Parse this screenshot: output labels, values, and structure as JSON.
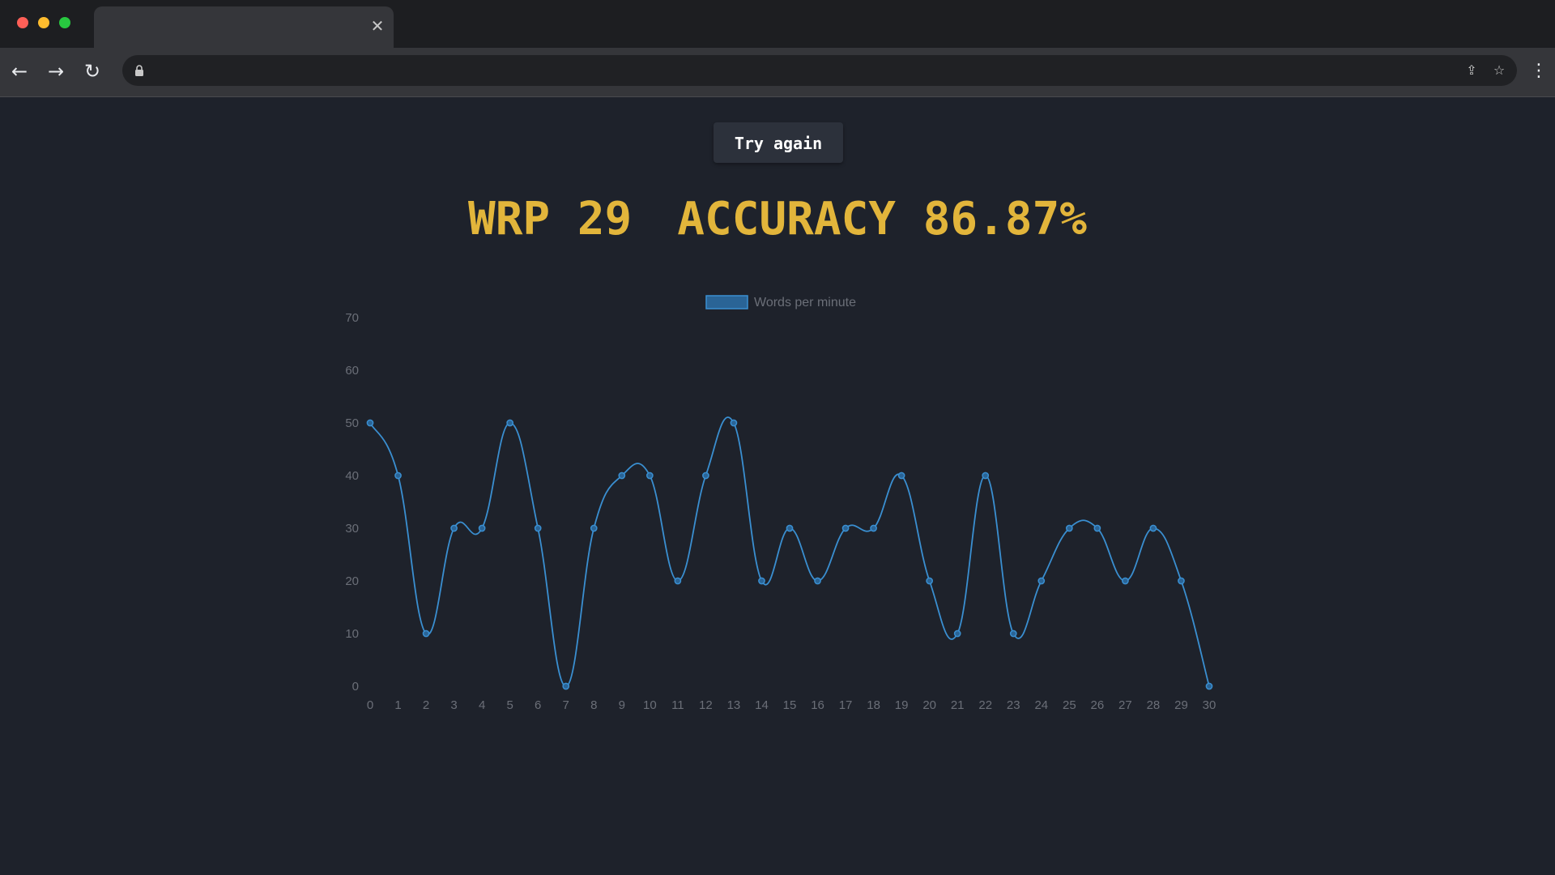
{
  "browser": {
    "tab_close_glyph": "✕",
    "icons": [
      "back-arrow-icon",
      "forward-arrow-icon",
      "reload-icon",
      "lock-icon",
      "share-icon",
      "star-icon",
      "more-vert-icon"
    ]
  },
  "page": {
    "try_again_label": "Try again",
    "wpm_text": "WRP 29",
    "accuracy_text": "ACCURACY 86.87%",
    "accent_color": "#e2b53b"
  },
  "chart_data": {
    "type": "line",
    "x": [
      0,
      1,
      2,
      3,
      4,
      5,
      6,
      7,
      8,
      9,
      10,
      11,
      12,
      13,
      14,
      15,
      16,
      17,
      18,
      19,
      20,
      21,
      22,
      23,
      24,
      25,
      26,
      27,
      28,
      29,
      30
    ],
    "series": [
      {
        "name": "Words per minute",
        "color": "#3a8fd1",
        "values": [
          50,
          40,
          10,
          30,
          30,
          50,
          30,
          0,
          30,
          40,
          40,
          20,
          40,
          50,
          20,
          30,
          20,
          30,
          30,
          40,
          20,
          10,
          40,
          10,
          20,
          30,
          30,
          20,
          30,
          20,
          0
        ]
      }
    ],
    "ylim": [
      0,
      70
    ],
    "yticks": [
      0,
      10,
      20,
      30,
      40,
      50,
      60,
      70
    ],
    "legend": "top-center",
    "grid": false
  }
}
